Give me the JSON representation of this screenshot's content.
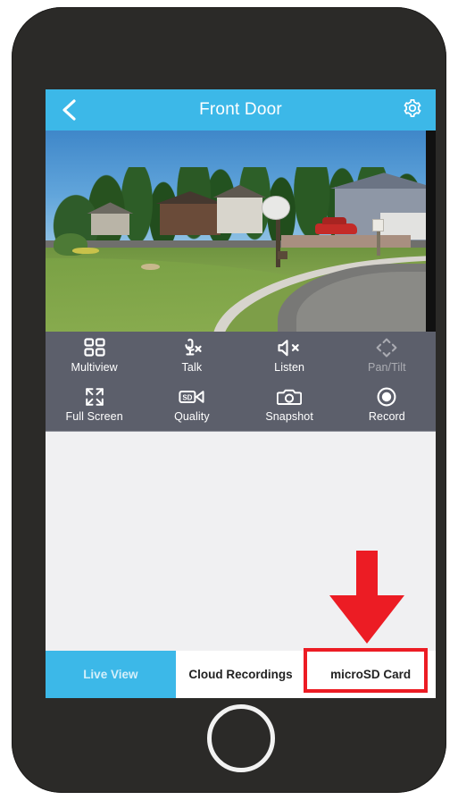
{
  "app": {
    "header": {
      "back_icon": "chevron-left-icon",
      "title": "Front Door",
      "settings_icon": "gear-icon",
      "background_color": "#3cb8e8"
    },
    "video": {
      "description": "Live camera view of a suburban street corner with green lawn, curved sidewalk, trees, houses and a red SUV parked in a driveway",
      "stop_sign_visible": "yes"
    },
    "controls": {
      "row1": [
        {
          "icon": "multiview-grid-icon",
          "label": "Multiview",
          "enabled": true
        },
        {
          "icon": "microphone-muted-icon",
          "label": "Talk",
          "enabled": true
        },
        {
          "icon": "speaker-muted-icon",
          "label": "Listen",
          "enabled": true
        },
        {
          "icon": "pan-tilt-arrows-icon",
          "label": "Pan/Tilt",
          "enabled": false
        }
      ],
      "row2": [
        {
          "icon": "fullscreen-expand-icon",
          "label": "Full Screen",
          "enabled": true
        },
        {
          "icon": "video-quality-sd-icon",
          "label": "Quality",
          "enabled": true
        },
        {
          "icon": "camera-snapshot-icon",
          "label": "Snapshot",
          "enabled": true
        },
        {
          "icon": "record-circle-icon",
          "label": "Record",
          "enabled": true
        }
      ],
      "quality_badge_text": "SD",
      "panel_color": "#5c5f6b"
    },
    "tabs": [
      {
        "label": "Live View",
        "active": true
      },
      {
        "label": "Cloud Recordings",
        "active": false
      },
      {
        "label": "microSD Card",
        "active": false,
        "highlighted": true
      }
    ],
    "annotation": {
      "arrow_icon": "red-down-arrow-icon",
      "arrow_color": "#ec1c24",
      "highlight_box_color": "#ec1c24",
      "points_to": "microSD Card"
    },
    "device": {
      "home_button_icon": "home-button-circle",
      "body_color": "#2b2a28"
    }
  }
}
